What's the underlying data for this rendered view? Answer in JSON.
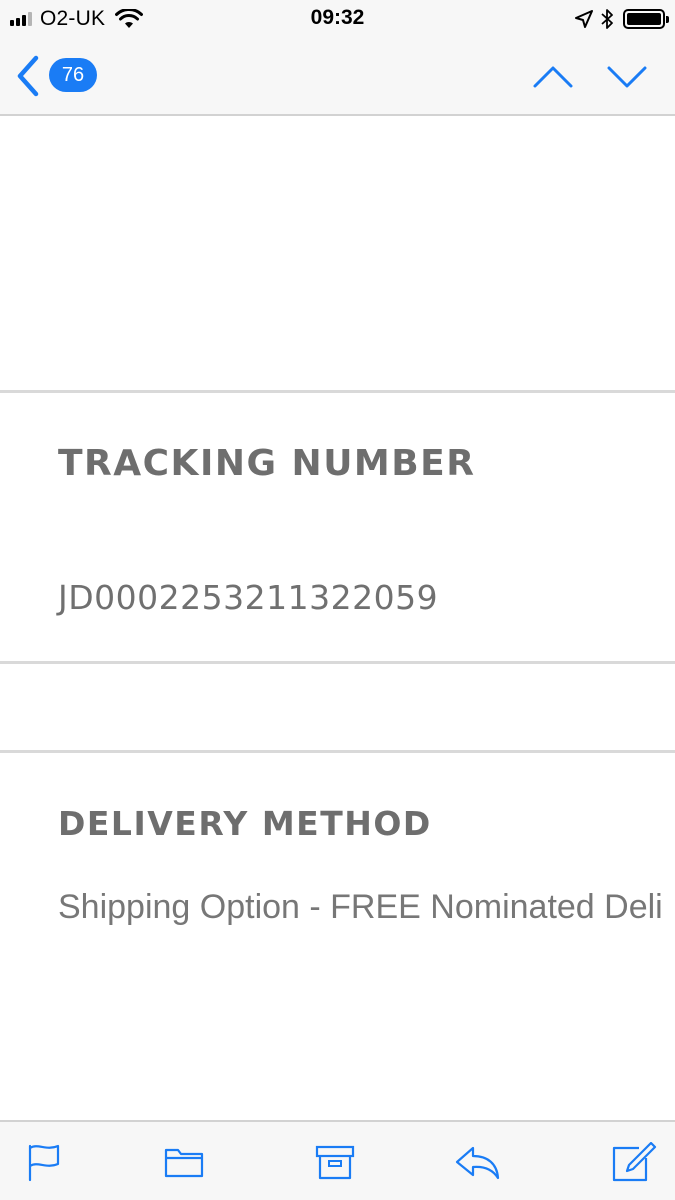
{
  "status_bar": {
    "carrier": "O2-UK",
    "time": "09:32",
    "signal_bars_active": 3,
    "battery_level": 1.0
  },
  "nav": {
    "unread_count": "76",
    "accent_color": "#1a7cf5",
    "icons": [
      "chevron-left-icon",
      "chevron-up-icon",
      "chevron-down-icon"
    ]
  },
  "email": {
    "tracking": {
      "title": "TRACKING NUMBER",
      "value": "JD0002253211322059"
    },
    "delivery": {
      "title": "DELIVERY METHOD",
      "value": "Shipping Option - FREE Nominated Deli"
    }
  },
  "toolbar": {
    "icons": [
      "flag-icon",
      "folder-icon",
      "archive-icon",
      "reply-icon",
      "compose-icon"
    ]
  }
}
